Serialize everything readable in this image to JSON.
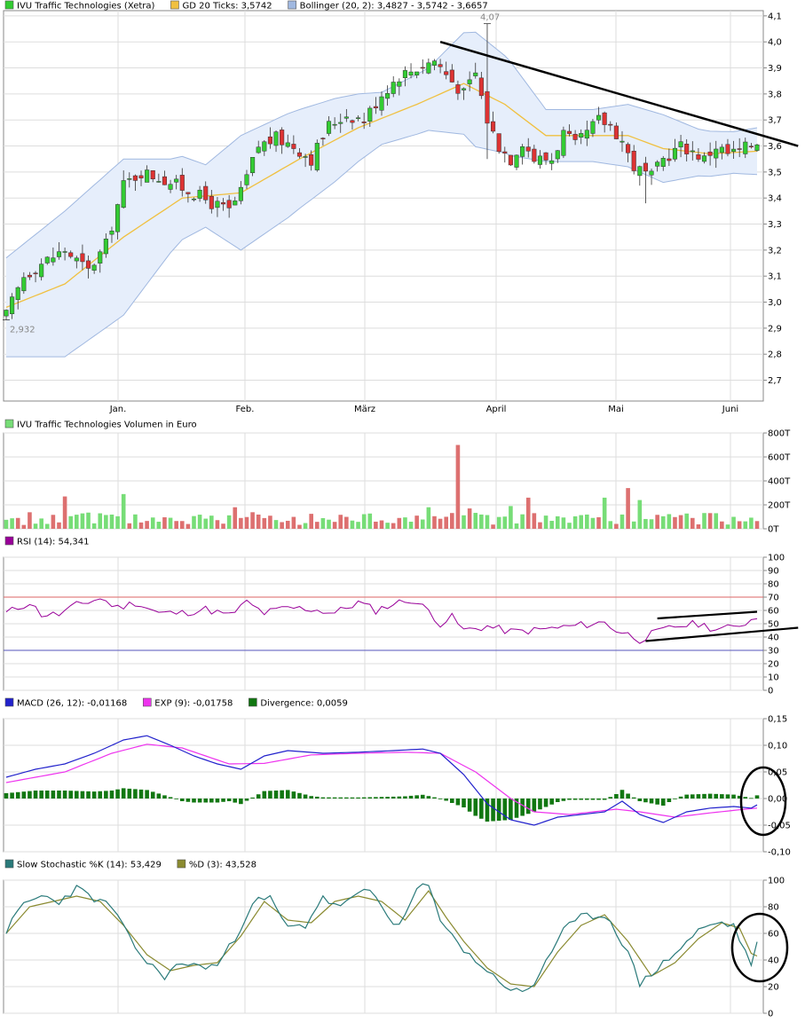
{
  "colors": {
    "up_candle": "#33cc33",
    "down_candle": "#dd3333",
    "gd20": "#f0c040",
    "bollinger_fill": "#e6eefb",
    "bollinger_line": "#a0b8e0",
    "volume_up": "#77dd77",
    "volume_down": "#dd7070",
    "rsi": "#990099",
    "rsi_70": "#dd6666",
    "rsi_30": "#5555bb",
    "macd": "#2222cc",
    "exp": "#ee33ee",
    "divergence": "#117711",
    "stoch_k": "#2a7a7a",
    "stoch_d": "#8a8a30",
    "grid": "#dddddd",
    "frame": "#888888",
    "annotation": "#000000"
  },
  "legends": {
    "price": [
      {
        "label": "IVU Traffic Technologies (Xetra)",
        "color": "#33cc33"
      },
      {
        "label": "GD 20 Ticks: 3,5742",
        "color": "#f0c040"
      },
      {
        "label": "Bollinger (20, 2): 3,4827 - 3,5742 - 3,6657",
        "color": "#a0b8e0"
      }
    ],
    "volume": [
      {
        "label": "IVU Traffic Technologies Volumen in Euro",
        "color": "#77dd77"
      }
    ],
    "rsi": [
      {
        "label": "RSI (14): 54,341",
        "color": "#990099"
      }
    ],
    "macd": [
      {
        "label": "MACD (26, 12): -0,01168",
        "color": "#2222cc"
      },
      {
        "label": "EXP (9): -0,01758",
        "color": "#ee33ee"
      },
      {
        "label": "Divergence: 0,0059",
        "color": "#117711"
      }
    ],
    "stoch": [
      {
        "label": "Slow Stochastic %K (14): 53,429",
        "color": "#2a7a7a"
      },
      {
        "label": "%D (3): 43,528",
        "color": "#8a8a30"
      }
    ]
  },
  "months": [
    "Jan.",
    "Feb.",
    "März",
    "April",
    "Mai",
    "Juni"
  ],
  "price_annotations": {
    "high": "4,07",
    "low": "2,932"
  },
  "chart_data": [
    {
      "type": "candlestick",
      "title": "IVU Traffic Technologies (Xetra)",
      "ylim": [
        2.62,
        4.12
      ],
      "y_ticks": [
        "2,7",
        "2,8",
        "2,9",
        "3,0",
        "3,1",
        "3,2",
        "3,3",
        "3,4",
        "3,5",
        "3,6",
        "3,7",
        "3,8",
        "3,9",
        "4,0",
        "4,1"
      ],
      "x_months": [
        "Jan.",
        "Feb.",
        "März",
        "April",
        "Mai",
        "Juni"
      ],
      "close_anchors": [
        [
          0,
          2.95
        ],
        [
          3,
          3.1
        ],
        [
          6,
          3.15
        ],
        [
          10,
          3.2
        ],
        [
          14,
          3.12
        ],
        [
          17,
          3.22
        ],
        [
          20,
          3.45
        ],
        [
          23,
          3.5
        ],
        [
          26,
          3.48
        ],
        [
          29,
          3.45
        ],
        [
          32,
          3.42
        ],
        [
          35,
          3.38
        ],
        [
          38,
          3.35
        ],
        [
          40,
          3.42
        ],
        [
          43,
          3.6
        ],
        [
          46,
          3.63
        ],
        [
          49,
          3.6
        ],
        [
          52,
          3.55
        ],
        [
          55,
          3.68
        ],
        [
          58,
          3.72
        ],
        [
          61,
          3.7
        ],
        [
          64,
          3.8
        ],
        [
          67,
          3.87
        ],
        [
          70,
          3.9
        ],
        [
          73,
          3.93
        ],
        [
          76,
          3.85
        ],
        [
          78,
          3.8
        ],
        [
          80,
          3.88
        ],
        [
          82,
          3.7
        ],
        [
          84,
          3.6
        ],
        [
          86,
          3.55
        ],
        [
          88,
          3.62
        ],
        [
          90,
          3.55
        ],
        [
          93,
          3.55
        ],
        [
          95,
          3.65
        ],
        [
          97,
          3.6
        ],
        [
          99,
          3.65
        ],
        [
          101,
          3.7
        ],
        [
          103,
          3.68
        ],
        [
          105,
          3.62
        ],
        [
          107,
          3.52
        ],
        [
          110,
          3.48
        ],
        [
          112,
          3.55
        ],
        [
          115,
          3.6
        ],
        [
          117,
          3.58
        ],
        [
          119,
          3.55
        ],
        [
          121,
          3.6
        ],
        [
          123,
          3.57
        ],
        [
          125,
          3.58
        ],
        [
          128,
          3.62
        ]
      ],
      "gd20_anchors": [
        [
          0,
          2.98
        ],
        [
          10,
          3.07
        ],
        [
          20,
          3.25
        ],
        [
          30,
          3.4
        ],
        [
          40,
          3.42
        ],
        [
          50,
          3.55
        ],
        [
          60,
          3.67
        ],
        [
          70,
          3.76
        ],
        [
          78,
          3.84
        ],
        [
          85,
          3.76
        ],
        [
          92,
          3.64
        ],
        [
          100,
          3.64
        ],
        [
          106,
          3.64
        ],
        [
          112,
          3.59
        ],
        [
          120,
          3.57
        ],
        [
          128,
          3.58
        ]
      ],
      "bollinger_width_anchors": [
        [
          0,
          0.19
        ],
        [
          10,
          0.28
        ],
        [
          20,
          0.3
        ],
        [
          28,
          0.18
        ],
        [
          34,
          0.12
        ],
        [
          40,
          0.22
        ],
        [
          48,
          0.2
        ],
        [
          56,
          0.16
        ],
        [
          64,
          0.1
        ],
        [
          72,
          0.12
        ],
        [
          80,
          0.22
        ],
        [
          86,
          0.18
        ],
        [
          92,
          0.1
        ],
        [
          100,
          0.1
        ],
        [
          106,
          0.12
        ],
        [
          112,
          0.13
        ],
        [
          118,
          0.09
        ],
        [
          124,
          0.08
        ],
        [
          128,
          0.09
        ]
      ],
      "trendline": {
        "from": [
          74,
          4.0
        ],
        "to": [
          135,
          3.6
        ]
      }
    },
    {
      "type": "bar",
      "title": "IVU Traffic Technologies Volumen in Euro",
      "ylim": [
        0,
        800
      ],
      "y_ticks": [
        "0T",
        "200T",
        "400T",
        "600T",
        "800T"
      ],
      "spikes": {
        "10": 270,
        "20": 290,
        "39": 180,
        "72": 180,
        "77": 700,
        "79": 170,
        "86": 190,
        "89": 260,
        "102": 260,
        "106": 340,
        "108": 240
      }
    },
    {
      "type": "line",
      "title": "RSI (14)",
      "ylim": [
        0,
        100
      ],
      "y_ticks": [
        "0",
        "10",
        "20",
        "30",
        "40",
        "50",
        "60",
        "70",
        "80",
        "90",
        "100"
      ],
      "reference_lines": [
        70,
        30
      ],
      "anchors": [
        [
          0,
          58
        ],
        [
          4,
          66
        ],
        [
          6,
          57
        ],
        [
          9,
          57
        ],
        [
          12,
          64
        ],
        [
          16,
          69
        ],
        [
          19,
          62
        ],
        [
          22,
          66
        ],
        [
          26,
          58
        ],
        [
          30,
          58
        ],
        [
          34,
          61
        ],
        [
          38,
          56
        ],
        [
          41,
          66
        ],
        [
          44,
          58
        ],
        [
          48,
          62
        ],
        [
          52,
          61
        ],
        [
          56,
          58
        ],
        [
          60,
          66
        ],
        [
          63,
          60
        ],
        [
          66,
          65
        ],
        [
          69,
          68
        ],
        [
          72,
          60
        ],
        [
          74,
          50
        ],
        [
          76,
          55
        ],
        [
          78,
          45
        ],
        [
          82,
          48
        ],
        [
          86,
          44
        ],
        [
          90,
          45
        ],
        [
          94,
          47
        ],
        [
          98,
          49
        ],
        [
          102,
          51
        ],
        [
          104,
          45
        ],
        [
          106,
          42
        ],
        [
          108,
          38
        ],
        [
          110,
          42
        ],
        [
          114,
          48
        ],
        [
          118,
          50
        ],
        [
          121,
          46
        ],
        [
          124,
          47
        ],
        [
          128,
          55
        ]
      ],
      "trendlines": [
        {
          "from": [
            111,
            54
          ],
          "to": [
            128,
            59
          ]
        },
        {
          "from": [
            109,
            37
          ],
          "to": [
            135,
            47
          ]
        }
      ]
    },
    {
      "type": "line",
      "title": "MACD (26, 12) / EXP (9) / Divergence",
      "ylim": [
        -0.1,
        0.15
      ],
      "y_ticks": [
        "-0,10",
        "-0,05",
        "0,00",
        "0,05",
        "0,10",
        "0,15"
      ],
      "macd_anchors": [
        [
          0,
          0.04
        ],
        [
          5,
          0.055
        ],
        [
          10,
          0.065
        ],
        [
          15,
          0.085
        ],
        [
          20,
          0.11
        ],
        [
          24,
          0.118
        ],
        [
          28,
          0.1
        ],
        [
          32,
          0.08
        ],
        [
          36,
          0.065
        ],
        [
          40,
          0.055
        ],
        [
          44,
          0.08
        ],
        [
          48,
          0.09
        ],
        [
          54,
          0.085
        ],
        [
          60,
          0.087
        ],
        [
          66,
          0.09
        ],
        [
          71,
          0.093
        ],
        [
          74,
          0.085
        ],
        [
          78,
          0.045
        ],
        [
          82,
          -0.01
        ],
        [
          86,
          -0.04
        ],
        [
          90,
          -0.05
        ],
        [
          94,
          -0.035
        ],
        [
          98,
          -0.03
        ],
        [
          102,
          -0.025
        ],
        [
          105,
          -0.005
        ],
        [
          108,
          -0.03
        ],
        [
          112,
          -0.045
        ],
        [
          116,
          -0.025
        ],
        [
          120,
          -0.018
        ],
        [
          124,
          -0.015
        ],
        [
          127,
          -0.018
        ],
        [
          128,
          -0.012
        ]
      ],
      "exp_anchors": [
        [
          0,
          0.03
        ],
        [
          10,
          0.05
        ],
        [
          18,
          0.085
        ],
        [
          24,
          0.102
        ],
        [
          30,
          0.095
        ],
        [
          38,
          0.065
        ],
        [
          44,
          0.066
        ],
        [
          52,
          0.082
        ],
        [
          60,
          0.085
        ],
        [
          68,
          0.087
        ],
        [
          74,
          0.085
        ],
        [
          80,
          0.05
        ],
        [
          86,
          0.0
        ],
        [
          90,
          -0.025
        ],
        [
          96,
          -0.03
        ],
        [
          104,
          -0.02
        ],
        [
          108,
          -0.025
        ],
        [
          114,
          -0.035
        ],
        [
          120,
          -0.027
        ],
        [
          126,
          -0.02
        ],
        [
          128,
          -0.018
        ]
      ],
      "circle_label": "ellipse"
    },
    {
      "type": "line",
      "title": "Slow Stochastic %K (14) / %D (3)",
      "ylim": [
        0,
        100
      ],
      "y_ticks": [
        "0",
        "20",
        "40",
        "60",
        "80",
        "100"
      ],
      "k_anchors": [
        [
          0,
          62
        ],
        [
          3,
          82
        ],
        [
          6,
          88
        ],
        [
          9,
          84
        ],
        [
          12,
          94
        ],
        [
          15,
          86
        ],
        [
          18,
          80
        ],
        [
          21,
          56
        ],
        [
          24,
          38
        ],
        [
          27,
          28
        ],
        [
          30,
          38
        ],
        [
          33,
          35
        ],
        [
          36,
          36
        ],
        [
          39,
          56
        ],
        [
          42,
          84
        ],
        [
          45,
          86
        ],
        [
          48,
          64
        ],
        [
          51,
          66
        ],
        [
          54,
          88
        ],
        [
          56,
          80
        ],
        [
          59,
          86
        ],
        [
          62,
          93
        ],
        [
          64,
          80
        ],
        [
          67,
          64
        ],
        [
          70,
          93
        ],
        [
          72,
          96
        ],
        [
          74,
          68
        ],
        [
          76,
          62
        ],
        [
          78,
          46
        ],
        [
          80,
          40
        ],
        [
          83,
          28
        ],
        [
          86,
          18
        ],
        [
          88,
          15
        ],
        [
          90,
          22
        ],
        [
          92,
          40
        ],
        [
          95,
          62
        ],
        [
          98,
          72
        ],
        [
          101,
          74
        ],
        [
          103,
          70
        ],
        [
          106,
          45
        ],
        [
          108,
          22
        ],
        [
          110,
          30
        ],
        [
          114,
          45
        ],
        [
          118,
          62
        ],
        [
          121,
          68
        ],
        [
          124,
          66
        ],
        [
          126,
          45
        ],
        [
          127,
          38
        ],
        [
          128,
          52
        ]
      ],
      "d_anchors": [
        [
          0,
          60
        ],
        [
          4,
          80
        ],
        [
          8,
          84
        ],
        [
          12,
          88
        ],
        [
          16,
          84
        ],
        [
          20,
          66
        ],
        [
          24,
          44
        ],
        [
          28,
          32
        ],
        [
          32,
          36
        ],
        [
          36,
          38
        ],
        [
          40,
          58
        ],
        [
          44,
          84
        ],
        [
          48,
          70
        ],
        [
          52,
          68
        ],
        [
          56,
          84
        ],
        [
          60,
          88
        ],
        [
          64,
          84
        ],
        [
          68,
          70
        ],
        [
          72,
          92
        ],
        [
          75,
          72
        ],
        [
          78,
          54
        ],
        [
          82,
          34
        ],
        [
          86,
          22
        ],
        [
          90,
          20
        ],
        [
          94,
          46
        ],
        [
          98,
          66
        ],
        [
          102,
          74
        ],
        [
          106,
          54
        ],
        [
          110,
          28
        ],
        [
          114,
          38
        ],
        [
          118,
          56
        ],
        [
          122,
          68
        ],
        [
          125,
          64
        ],
        [
          127,
          45
        ],
        [
          128,
          43
        ]
      ],
      "circle_label": "ellipse"
    }
  ]
}
